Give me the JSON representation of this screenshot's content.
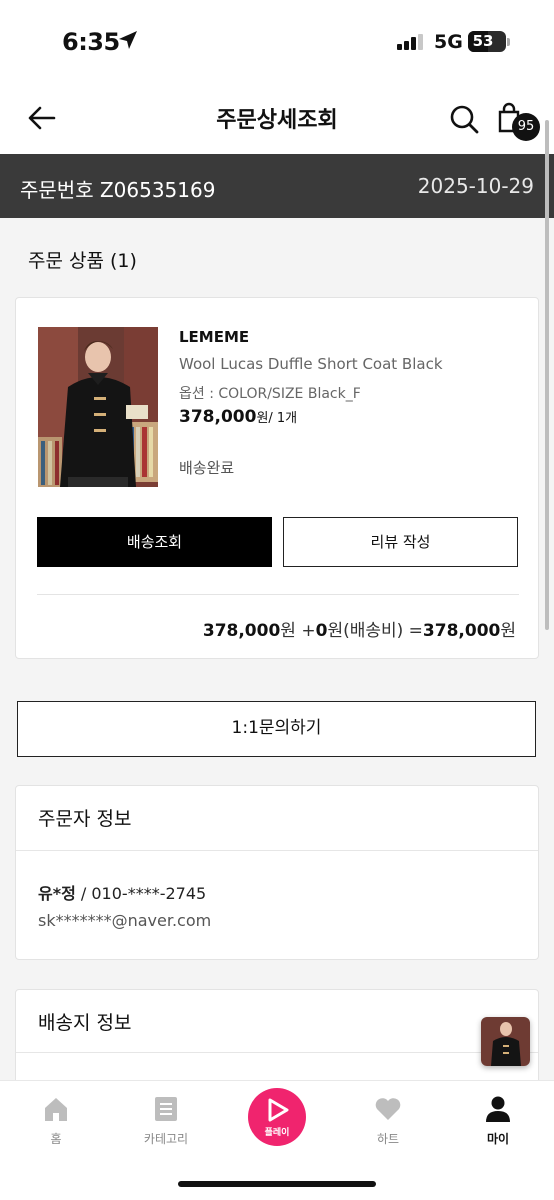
{
  "status_bar": {
    "time": "6:35",
    "network": "5G",
    "battery": "53",
    "battery_level": 0.53
  },
  "header": {
    "title": "주문상세조회",
    "cart_count": "95"
  },
  "order": {
    "number_label": "주문번호 Z06535169",
    "date": "2025-10-29"
  },
  "products_section": {
    "heading": "주문 상품 (1)"
  },
  "product": {
    "brand": "LEMEME",
    "name": "Wool Lucas Duffle Short Coat Black",
    "option": "옵션 : COLOR/SIZE Black_F",
    "price": "378,000",
    "price_unit": "원/ 1개",
    "status": "배송완료",
    "track_button": "배송조회",
    "review_button": "리뷰 작성",
    "total": {
      "items": "378,000",
      "won1": "원 +",
      "shipping": "0",
      "shipping_label": "원(배송비) =",
      "sum": "378,000",
      "won2": "원"
    }
  },
  "inquiry_button": "1:1문의하기",
  "orderer": {
    "title": "주문자 정보",
    "name": "유*정",
    "phone": " / 010-****-2745",
    "email": "sk*******@naver.com"
  },
  "shipping": {
    "title": "배송지 정보"
  },
  "tab_bar": {
    "home": "홈",
    "category": "카테고리",
    "play": "플레이",
    "heart": "하트",
    "my": "마이"
  },
  "colors": {
    "accent": "#f0246e",
    "order_bar": "#3a3a3a",
    "primary_button": "#000000"
  }
}
